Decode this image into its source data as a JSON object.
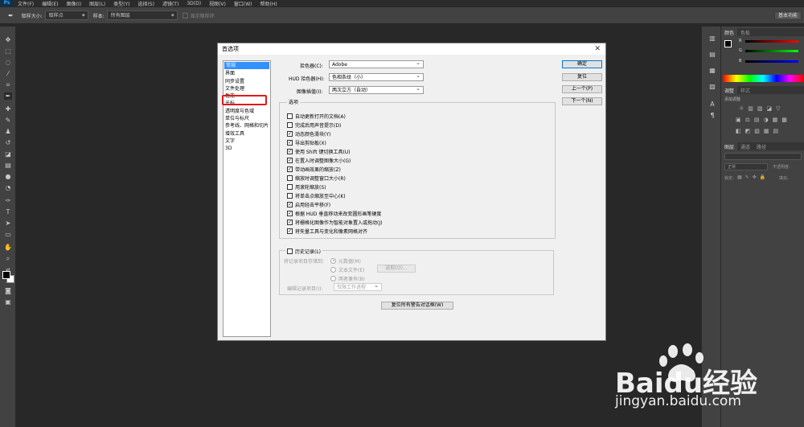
{
  "app": {
    "name": "Ps"
  },
  "menu": [
    "文件(F)",
    "编辑(E)",
    "图像(I)",
    "图层(L)",
    "类型(Y)",
    "选择(S)",
    "滤镜(T)",
    "3D(D)",
    "视图(V)",
    "窗口(W)",
    "帮助(H)"
  ],
  "options_bar": {
    "sample_size_label": "取样大小:",
    "sample_size_value": "取样点",
    "sample_label": "样本:",
    "sample_value": "所有图层",
    "show_ring_label": "显示取样环",
    "workspace_button": "基本功能"
  },
  "right_panels": {
    "color_tabs": [
      "颜色",
      "色板"
    ],
    "adjust_tabs": [
      "调整",
      "样式"
    ],
    "adjust_hint": "添加调整",
    "layers_tabs": [
      "图层",
      "通道",
      "路径"
    ],
    "blend_mode": "正常",
    "opacity_label": "不透明度:",
    "lock_label": "锁定:",
    "fill_label": "填充:",
    "channel_labels": [
      "R",
      "G",
      "B"
    ]
  },
  "dialog": {
    "title": "首选项",
    "categories": [
      "常规",
      "界面",
      "同步设置",
      "文件处理",
      "性能",
      "光标",
      "透明度与色域",
      "单位与标尺",
      "参考线、网格和切片",
      "增效工具",
      "文字",
      "3D"
    ],
    "selected_category": "常规",
    "color_picker_label": "拾色器(C):",
    "color_picker_value": "Adobe",
    "hud_picker_label": "HUD 拾色器(H):",
    "hud_picker_value": "色相条纹（小）",
    "interp_label": "图像插值(I):",
    "interp_value": "两次立方（自动）",
    "buttons": {
      "ok": "确定",
      "reset": "复位",
      "prev": "上一个(P)",
      "next": "下一个(N)"
    },
    "options_group": "选项",
    "options": [
      {
        "label": "自动更新打开的文档(A)",
        "checked": false
      },
      {
        "label": "完成后用声音提示(D)",
        "checked": false
      },
      {
        "label": "动态颜色滑块(Y)",
        "checked": true
      },
      {
        "label": "导出剪贴板(X)",
        "checked": true
      },
      {
        "label": "使用 Shift 键切换工具(U)",
        "checked": true
      },
      {
        "label": "在置入时调整图像大小(G)",
        "checked": true
      },
      {
        "label": "带动画效果的缩放(Z)",
        "checked": true
      },
      {
        "label": "缩放时调整窗口大小(R)",
        "checked": false
      },
      {
        "label": "用滚轮缩放(S)",
        "checked": false
      },
      {
        "label": "将单击点缩放至中心(K)",
        "checked": false
      },
      {
        "label": "启用轻击平移(F)",
        "checked": true
      },
      {
        "label": "根据 HUD 垂直移动来改变圆形画笔硬度",
        "checked": true
      },
      {
        "label": "将栅格化图像作为智能对象置入或拖动(J)",
        "checked": true
      },
      {
        "label": "将矢量工具与变化和像素网格对齐",
        "checked": true
      }
    ],
    "history": {
      "label": "历史记录(L)",
      "save_to_label": "将记录项目存储到:",
      "radio_meta": "元数据(M)",
      "radio_text": "文本文件(E)",
      "radio_both": "两者兼有(B)",
      "choose_button": "选取(O)...",
      "edit_log_label": "编辑记录项目(I):",
      "edit_log_value": "仅限工作进程"
    },
    "reset_warnings": "复位所有警告对话框(W)"
  },
  "watermark": {
    "brand_text": "Baidu经验",
    "url": "jingyan.baidu.com"
  }
}
